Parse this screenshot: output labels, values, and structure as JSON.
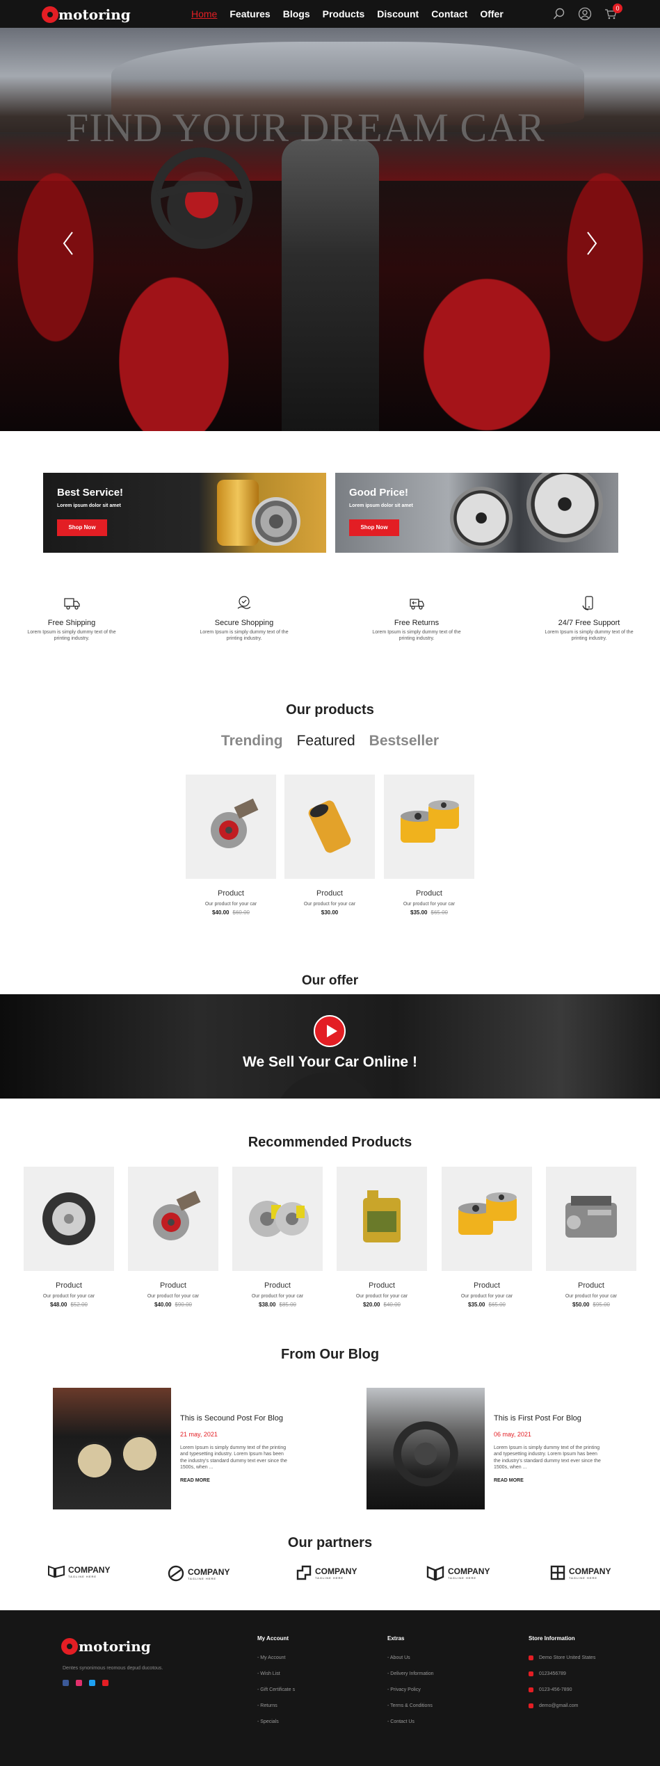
{
  "brand": "motoring",
  "nav": [
    "Home",
    "Features",
    "Blogs",
    "Products",
    "Discount",
    "Contact",
    "Offer"
  ],
  "cart_count": "0",
  "hero": {
    "title": "FIND YOUR DREAM CAR"
  },
  "banners": [
    {
      "title": "Best Service!",
      "text": "Lorem ipsum dolor sit amet",
      "button": "Shop Now"
    },
    {
      "title": "Good Price!",
      "text": "Lorem ipsum dolor sit amet",
      "button": "Shop Now"
    }
  ],
  "features": [
    {
      "title": "Free Shipping",
      "text": "Lorem Ipsum is simply dummy text of the printing industry.",
      "icon": "truck-icon"
    },
    {
      "title": "Secure Shopping",
      "text": "Lorem Ipsum is simply dummy text of the printing industry.",
      "icon": "secure-hand-icon"
    },
    {
      "title": "Free Returns",
      "text": "Lorem Ipsum is simply dummy text of the printing industry.",
      "icon": "return-truck-icon"
    },
    {
      "title": "24/7 Free Support",
      "text": "Lorem Ipsum is simply dummy text of the printing industry.",
      "icon": "support-phone-icon"
    }
  ],
  "products_section": {
    "title": "Our products",
    "tabs": [
      "Trending",
      "Featured",
      "Bestseller"
    ],
    "items": [
      {
        "name": "Product",
        "desc": "Our product for your car",
        "price": "$40.00",
        "old": "$60.00",
        "image": "turbocharger"
      },
      {
        "name": "Product",
        "desc": "Our product for your car",
        "price": "$30.00",
        "old": "",
        "image": "oil-filter"
      },
      {
        "name": "Product",
        "desc": "Our product for your car",
        "price": "$35.00",
        "old": "$65.00",
        "image": "oil-filters-pair"
      }
    ]
  },
  "offer": {
    "section_title": "Our offer",
    "headline": "We Sell Your Car Online !"
  },
  "recommended": {
    "title": "Recommended Products",
    "items": [
      {
        "name": "Product",
        "desc": "Our product for your car",
        "price": "$48.00",
        "old": "$52.00",
        "image": "tire"
      },
      {
        "name": "Product",
        "desc": "Our product for your car",
        "price": "$40.00",
        "old": "$90.00",
        "image": "turbocharger"
      },
      {
        "name": "Product",
        "desc": "Our product for your car",
        "price": "$38.00",
        "old": "$85.00",
        "image": "brake-discs"
      },
      {
        "name": "Product",
        "desc": "Our product for your car",
        "price": "$20.00",
        "old": "$40.00",
        "image": "engine-oil"
      },
      {
        "name": "Product",
        "desc": "Our product for your car",
        "price": "$35.00",
        "old": "$65.00",
        "image": "oil-filters-pair"
      },
      {
        "name": "Product",
        "desc": "Our product for your car",
        "price": "$50.00",
        "old": "$95.00",
        "image": "engine"
      }
    ]
  },
  "blog": {
    "title": "From Our Blog",
    "posts": [
      {
        "title": "This is Secound Post For Blog",
        "date": "21 may, 2021",
        "text": "Lorem Ipsum is simply dummy text of the printing and typesetting industry. Lorem Ipsum has been the industry's standard dummy text ever since the 1500s, when ...",
        "more": "READ MORE"
      },
      {
        "title": "This is First Post For Blog",
        "date": "06 may, 2021",
        "text": "Lorem Ipsum is simply dummy text of the printing and typesetting industry. Lorem Ipsum has been the industry's standard dummy text ever since the 1500s, when ...",
        "more": "READ MORE"
      }
    ]
  },
  "partners": {
    "title": "Our partners",
    "items": [
      {
        "name": "COMPANY",
        "tagline": "TAGLINE HERE"
      },
      {
        "name": "COMPANY",
        "tagline": "TAGLINE HERE"
      },
      {
        "name": "COMPANY",
        "tagline": "TAGLINE HERE"
      },
      {
        "name": "COMPANY",
        "tagline": "TAGLINE HERE"
      },
      {
        "name": "COMPANY",
        "tagline": "TAGLINE HERE"
      }
    ]
  },
  "footer": {
    "brand": "motoring",
    "tagline": "Dentes synonimous reomous depud ducotous.",
    "social": [
      "facebook-icon",
      "instagram-icon",
      "twitter-icon",
      "youtube-icon"
    ],
    "account": {
      "title": "My Account",
      "items": [
        "- My Account",
        "- Wish List",
        "- Gift Certificate s",
        "- Returns",
        "- Specials"
      ]
    },
    "extras": {
      "title": "Extras",
      "items": [
        "- About Us",
        "- Delivery Information",
        "- Privacy Policy",
        "- Terms & Conditions",
        "- Contact Us"
      ]
    },
    "store": {
      "title": "Store Information",
      "items": [
        "Demo Store United States",
        "0123456789",
        "0123-456-7890",
        "demo@gmail.com"
      ]
    }
  },
  "colors": {
    "accent": "#e31e24",
    "header": "#141414",
    "footer": "#161616",
    "card_bg": "#efefef"
  }
}
